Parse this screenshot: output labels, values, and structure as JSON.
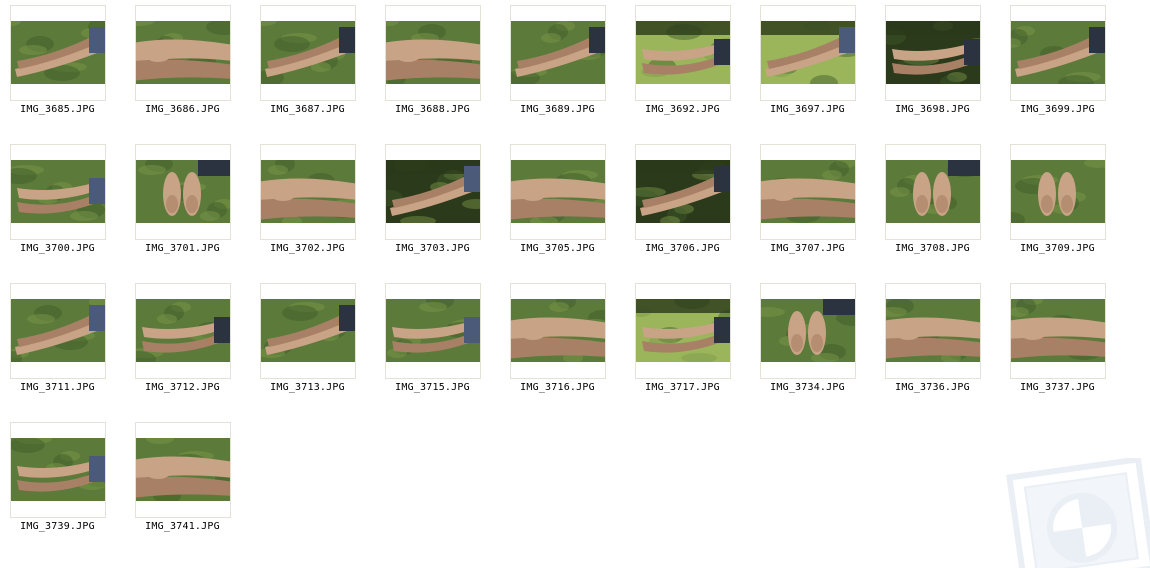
{
  "files": [
    {
      "name": "IMG_3685.JPG",
      "style": "grass-legs"
    },
    {
      "name": "IMG_3686.JPG",
      "style": "closeup-feet"
    },
    {
      "name": "IMG_3687.JPG",
      "style": "grass-legs"
    },
    {
      "name": "IMG_3688.JPG",
      "style": "closeup-feet"
    },
    {
      "name": "IMG_3689.JPG",
      "style": "grass-legs"
    },
    {
      "name": "IMG_3692.JPG",
      "style": "bright-lawn"
    },
    {
      "name": "IMG_3697.JPG",
      "style": "bright-lawn"
    },
    {
      "name": "IMG_3698.JPG",
      "style": "dark-foliage"
    },
    {
      "name": "IMG_3699.JPG",
      "style": "grass-legs"
    },
    {
      "name": "IMG_3700.JPG",
      "style": "grass-legs"
    },
    {
      "name": "IMG_3701.JPG",
      "style": "soles-up"
    },
    {
      "name": "IMG_3702.JPG",
      "style": "closeup-feet"
    },
    {
      "name": "IMG_3703.JPG",
      "style": "dark-foliage"
    },
    {
      "name": "IMG_3705.JPG",
      "style": "closeup-feet"
    },
    {
      "name": "IMG_3706.JPG",
      "style": "dark-foliage"
    },
    {
      "name": "IMG_3707.JPG",
      "style": "closeup-feet"
    },
    {
      "name": "IMG_3708.JPG",
      "style": "soles-up"
    },
    {
      "name": "IMG_3709.JPG",
      "style": "soles-up"
    },
    {
      "name": "IMG_3711.JPG",
      "style": "grass-legs"
    },
    {
      "name": "IMG_3712.JPG",
      "style": "grass-legs"
    },
    {
      "name": "IMG_3713.JPG",
      "style": "grass-legs"
    },
    {
      "name": "IMG_3715.JPG",
      "style": "grass-legs"
    },
    {
      "name": "IMG_3716.JPG",
      "style": "closeup-feet"
    },
    {
      "name": "IMG_3717.JPG",
      "style": "bright-lawn"
    },
    {
      "name": "IMG_3734.JPG",
      "style": "soles-up"
    },
    {
      "name": "IMG_3736.JPG",
      "style": "closeup-feet"
    },
    {
      "name": "IMG_3737.JPG",
      "style": "closeup-feet"
    },
    {
      "name": "IMG_3739.JPG",
      "style": "grass-legs"
    },
    {
      "name": "IMG_3741.JPG",
      "style": "closeup-feet"
    }
  ],
  "colors": {
    "grass_dark": "#3f5a2a",
    "grass_mid": "#5c7a3a",
    "grass_light": "#7e9a4c",
    "lawn_bright": "#9ab55a",
    "foliage_dark": "#2a3a1a",
    "skin": "#c9a386",
    "skin_shadow": "#a88066",
    "fabric_dark": "#2c3340",
    "denim": "#4a5a78",
    "frame_border": "#e4e1d6",
    "caption_text": "#000000",
    "watermark": "#d9e2ee"
  },
  "watermark_icon": "windows-logo-watermark"
}
